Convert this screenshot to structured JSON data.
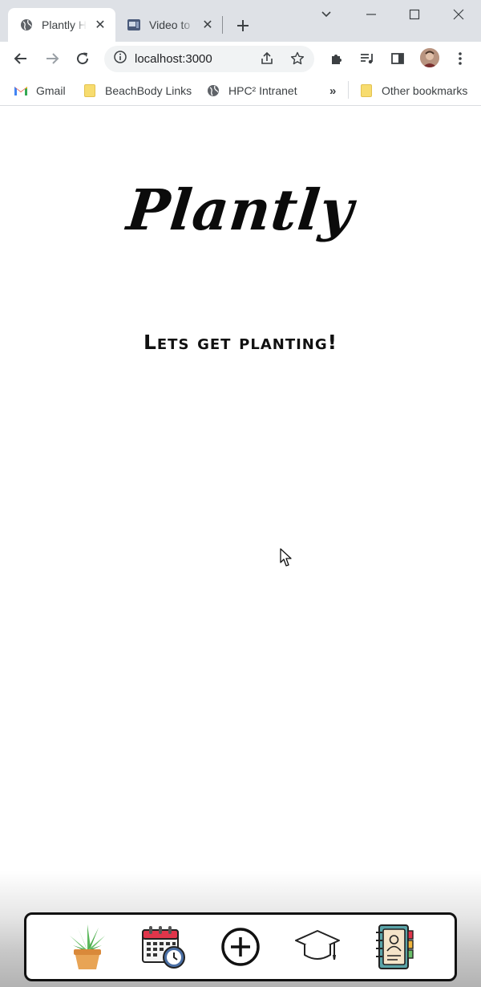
{
  "browser": {
    "tabs": [
      {
        "title": "Plantly H",
        "active": true,
        "favicon": "globe-icon"
      },
      {
        "title": "Video to",
        "active": false,
        "favicon": "video-converter-icon"
      }
    ],
    "address": "localhost:3000",
    "bookmarks": [
      {
        "label": "Gmail",
        "icon": "gmail-icon"
      },
      {
        "label": "BeachBody Links",
        "icon": "folder-icon"
      },
      {
        "label": "HPC² Intranet",
        "icon": "globe-icon"
      },
      {
        "label": "Other bookmarks",
        "icon": "folder-icon"
      }
    ],
    "overflow_label": "»"
  },
  "page": {
    "logo": "Plantly",
    "tagline": "Lets get planting!"
  },
  "bottom_nav": {
    "items": [
      {
        "name": "plants",
        "icon": "potted-plant-icon"
      },
      {
        "name": "schedule",
        "icon": "calendar-clock-icon"
      },
      {
        "name": "add",
        "icon": "plus-circle-icon"
      },
      {
        "name": "learn",
        "icon": "graduation-cap-icon"
      },
      {
        "name": "contacts",
        "icon": "address-book-icon"
      }
    ]
  },
  "colors": {
    "chrome_bg": "#dee1e6",
    "omnibox_bg": "#f1f3f4",
    "nav_border": "#111111",
    "plant_green": "#5cb85c",
    "pot_orange": "#e8a455"
  }
}
